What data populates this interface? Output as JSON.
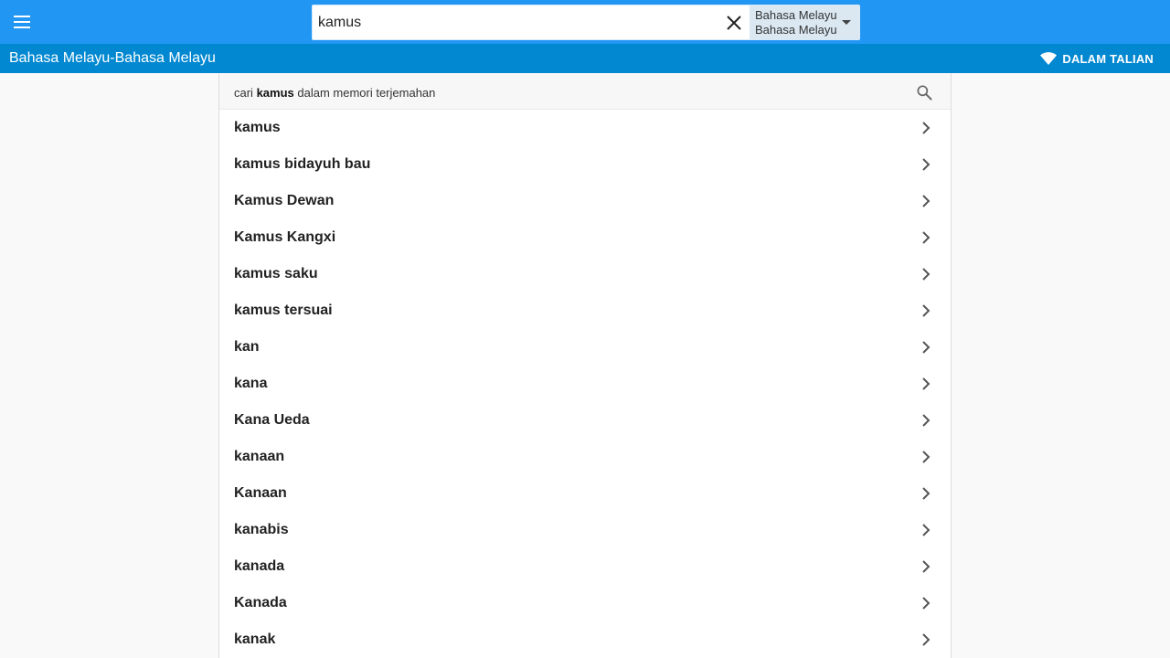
{
  "header": {
    "search": {
      "value": "kamus",
      "placeholder": ""
    },
    "language": {
      "line1": "Bahasa Melayu",
      "line2": "Bahasa Melayu"
    }
  },
  "subheader": {
    "title": "Bahasa Melayu-Bahasa Melayu",
    "status": "DALAM TALIAN"
  },
  "translation_memory": {
    "prefix": "cari ",
    "term": "kamus",
    "suffix": " dalam memori terjemahan"
  },
  "suggestions": [
    {
      "label": "kamus"
    },
    {
      "label": "kamus bidayuh bau"
    },
    {
      "label": "Kamus Dewan"
    },
    {
      "label": "Kamus Kangxi"
    },
    {
      "label": "kamus saku"
    },
    {
      "label": "kamus tersuai"
    },
    {
      "label": "kan"
    },
    {
      "label": "kana"
    },
    {
      "label": "Kana Ueda"
    },
    {
      "label": "kanaan"
    },
    {
      "label": "Kanaan"
    },
    {
      "label": "kanabis"
    },
    {
      "label": "kanada"
    },
    {
      "label": "Kanada"
    },
    {
      "label": "kanak"
    }
  ],
  "icons": {
    "menu": "menu-icon",
    "clear": "close-icon",
    "dropdown": "caret-down-icon",
    "online": "wifi-icon",
    "search": "search-icon",
    "chevron": "chevron-right-icon"
  },
  "colors": {
    "topbar": "#2196f3",
    "subbar": "#0288d1",
    "language_bg": "#dbe8f2"
  }
}
